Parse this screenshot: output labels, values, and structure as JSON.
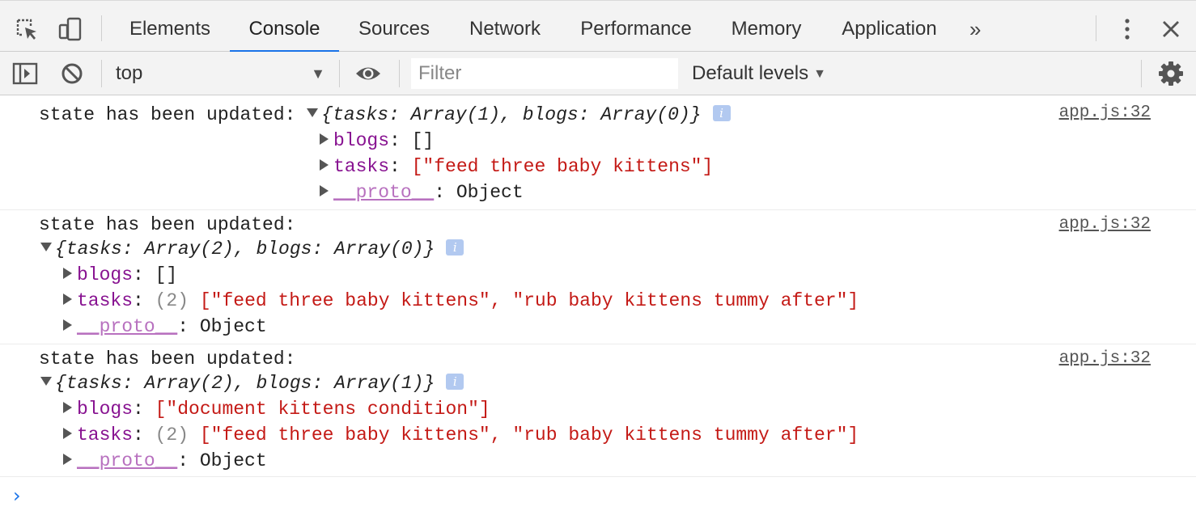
{
  "tabs": [
    {
      "label": "Elements"
    },
    {
      "label": "Console",
      "active": true
    },
    {
      "label": "Sources"
    },
    {
      "label": "Network"
    },
    {
      "label": "Performance"
    },
    {
      "label": "Memory"
    },
    {
      "label": "Application"
    }
  ],
  "more_tabs_label": "»",
  "toolbar": {
    "context": "top",
    "filter_placeholder": "Filter",
    "levels": "Default levels"
  },
  "messages": [
    {
      "text": "state has been updated:",
      "summary": "{tasks: Array(1), blogs: Array(0)}",
      "source": "app.js:32",
      "props": [
        {
          "key": "blogs",
          "value": "[]"
        },
        {
          "key": "tasks",
          "value": "[\"feed three baby kittens\"]"
        },
        {
          "key": "__proto__",
          "value": "Object"
        }
      ]
    },
    {
      "text": "state has been updated:",
      "summary": "{tasks: Array(2), blogs: Array(0)}",
      "source": "app.js:32",
      "props": [
        {
          "key": "blogs",
          "value": "[]"
        },
        {
          "key": "tasks",
          "count": "(2)",
          "value": "[\"feed three baby kittens\", \"rub baby kittens tummy after\"]"
        },
        {
          "key": "__proto__",
          "value": "Object"
        }
      ]
    },
    {
      "text": "state has been updated:",
      "summary": "{tasks: Array(2), blogs: Array(1)}",
      "source": "app.js:32",
      "props": [
        {
          "key": "blogs",
          "value": "[\"document kittens condition\"]"
        },
        {
          "key": "tasks",
          "count": "(2)",
          "value": "[\"feed three baby kittens\", \"rub baby kittens tummy after\"]"
        },
        {
          "key": "__proto__",
          "value": "Object"
        }
      ]
    }
  ],
  "prompt_symbol": "›",
  "info_badge": "i",
  "colors": {
    "accent": "#1a73e8",
    "key": "#881391",
    "string": "#c41a16",
    "proto": "#b871bf"
  },
  "icons": [
    "inspect-element-icon",
    "device-toolbar-icon",
    "kebab-menu-icon",
    "close-icon",
    "show-sidebar-icon",
    "clear-console-icon",
    "live-expression-eye-icon",
    "settings-gear-icon"
  ]
}
